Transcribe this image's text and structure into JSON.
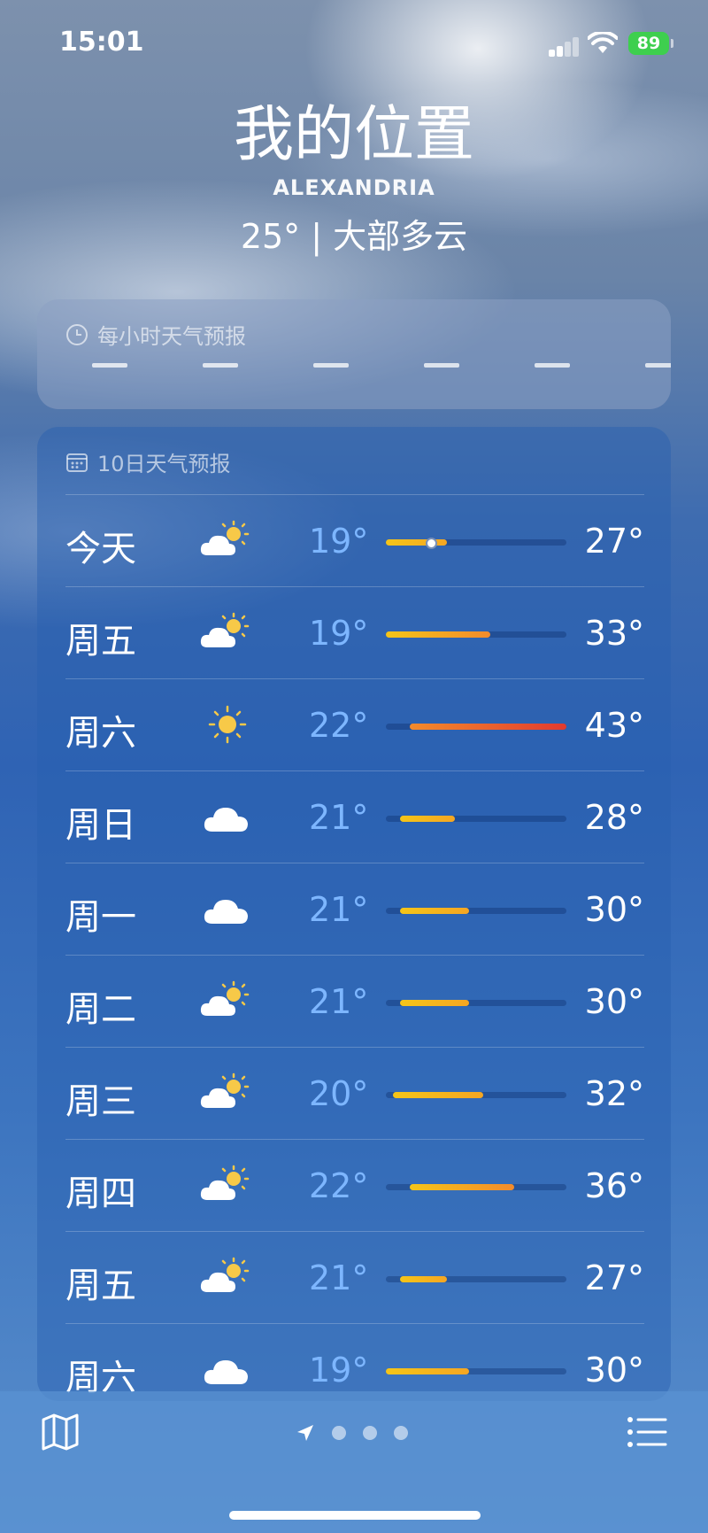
{
  "status_bar": {
    "time": "15:01",
    "battery": "89"
  },
  "header": {
    "title": "我的位置",
    "city": "ALEXANDRIA",
    "current": "25° | 大部多云"
  },
  "hourly": {
    "label": "每小时天气预报"
  },
  "daily": {
    "label": "10日天气预报",
    "days": [
      {
        "day": "今天",
        "icon": "partly-sunny-icon",
        "low": "19°",
        "high": "27°",
        "range_start": 0.0,
        "range_end": 0.34,
        "current_dot": 0.25
      },
      {
        "day": "周五",
        "icon": "partly-sunny-icon",
        "low": "19°",
        "high": "33°",
        "range_start": 0.0,
        "range_end": 0.58
      },
      {
        "day": "周六",
        "icon": "sun-icon",
        "low": "22°",
        "high": "43°",
        "range_start": 0.13,
        "range_end": 1.0
      },
      {
        "day": "周日",
        "icon": "cloud-icon",
        "low": "21°",
        "high": "28°",
        "range_start": 0.08,
        "range_end": 0.38
      },
      {
        "day": "周一",
        "icon": "cloud-icon",
        "low": "21°",
        "high": "30°",
        "range_start": 0.08,
        "range_end": 0.46
      },
      {
        "day": "周二",
        "icon": "partly-sunny-icon",
        "low": "21°",
        "high": "30°",
        "range_start": 0.08,
        "range_end": 0.46
      },
      {
        "day": "周三",
        "icon": "partly-sunny-icon",
        "low": "20°",
        "high": "32°",
        "range_start": 0.04,
        "range_end": 0.54
      },
      {
        "day": "周四",
        "icon": "partly-sunny-icon",
        "low": "22°",
        "high": "36°",
        "range_start": 0.13,
        "range_end": 0.71
      },
      {
        "day": "周五",
        "icon": "partly-sunny-icon",
        "low": "21°",
        "high": "27°",
        "range_start": 0.08,
        "range_end": 0.34
      },
      {
        "day": "周六",
        "icon": "cloud-icon",
        "low": "19°",
        "high": "30°",
        "range_start": 0.0,
        "range_end": 0.46
      }
    ]
  },
  "colors": {
    "low_temp": "#7db6ff",
    "bar_yellow": "#f5c518",
    "bar_orange": "#f38b2c",
    "bar_red": "#e23a2e",
    "battery": "#3ecf4e"
  },
  "bottom_bar": {
    "left_icon": "map-icon",
    "right_icon": "list-icon",
    "page_dots": 3
  }
}
